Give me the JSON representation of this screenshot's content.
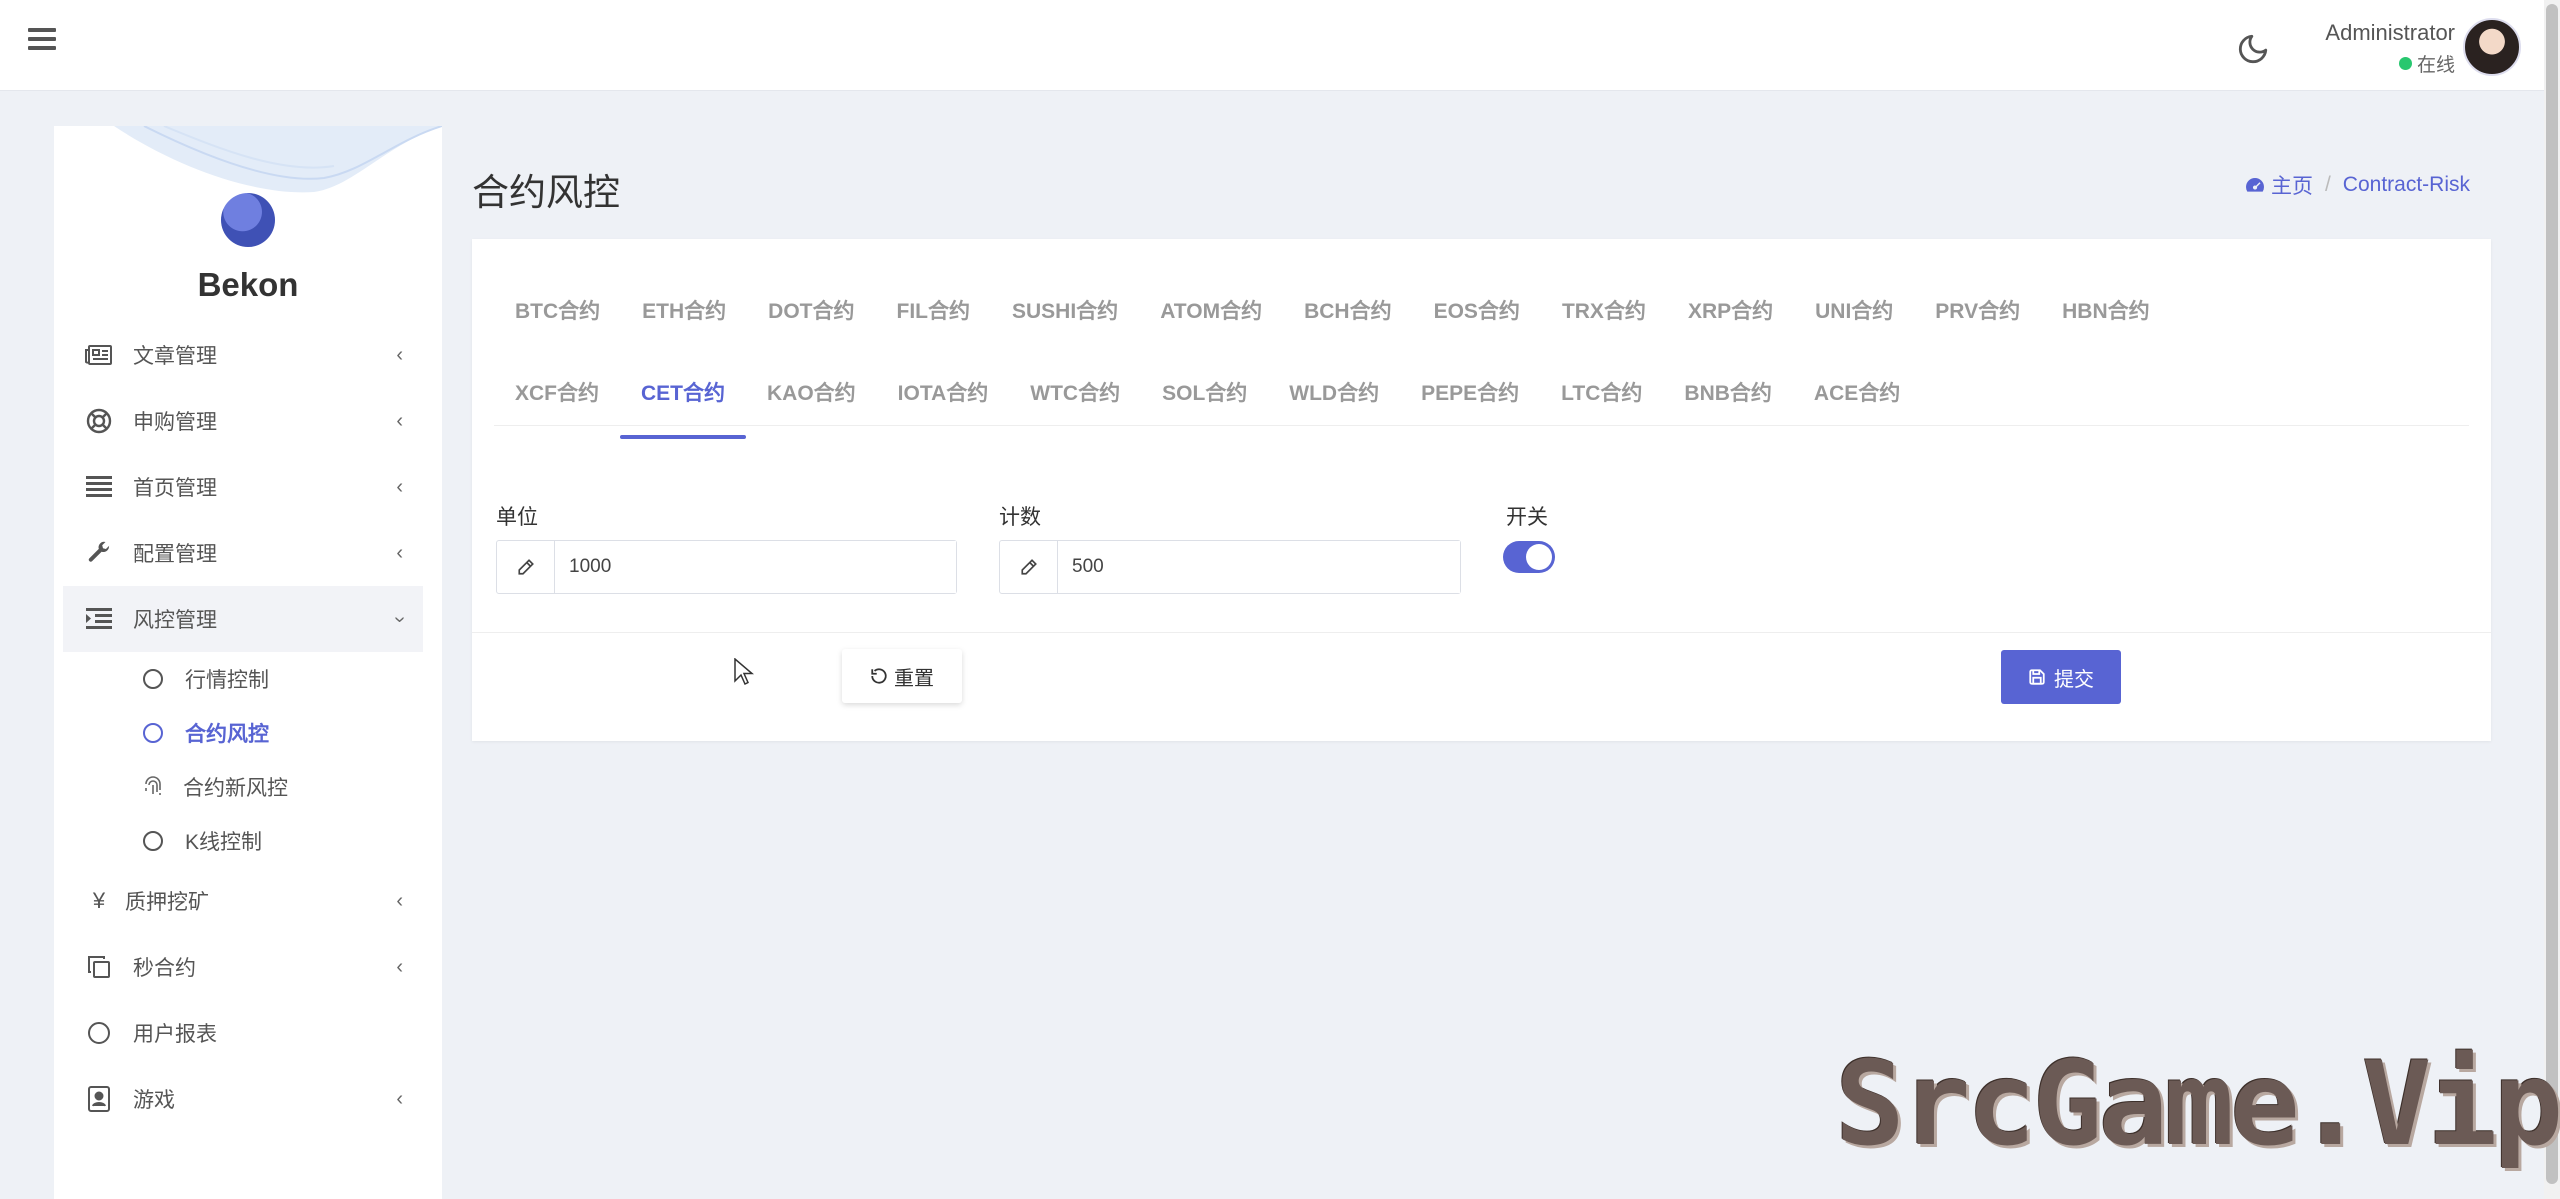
{
  "topbar": {
    "user_name": "Administrator",
    "user_status": "在线"
  },
  "sidebar": {
    "brand": "Bekon",
    "items": [
      {
        "label": "文章管理",
        "icon": "newspaper-icon"
      },
      {
        "label": "申购管理",
        "icon": "lifebuoy-icon"
      },
      {
        "label": "首页管理",
        "icon": "list-icon"
      },
      {
        "label": "配置管理",
        "icon": "wrench-icon"
      },
      {
        "label": "风控管理",
        "icon": "indent-icon"
      }
    ],
    "subitems": [
      {
        "label": "行情控制"
      },
      {
        "label": "合约风控"
      },
      {
        "label": "合约新风控"
      },
      {
        "label": "K线控制"
      }
    ],
    "items_after": [
      {
        "label": "质押挖矿",
        "icon": "yen-icon"
      },
      {
        "label": "秒合约",
        "icon": "copy-icon"
      },
      {
        "label": "用户报表",
        "icon": "circle-icon"
      },
      {
        "label": "游戏",
        "icon": "id-card-icon"
      }
    ]
  },
  "page": {
    "title": "合约风控",
    "breadcrumb_home": "主页",
    "breadcrumb_current": "Contract-Risk"
  },
  "tabs": {
    "row1": [
      "BTC合约",
      "ETH合约",
      "DOT合约",
      "FIL合约",
      "SUSHI合约",
      "ATOM合约",
      "BCH合约",
      "EOS合约",
      "TRX合约",
      "XRP合约",
      "UNI合约",
      "PRV合约",
      "HBN合约"
    ],
    "row2": [
      "XCF合约",
      "CET合约",
      "KAO合约",
      "IOTA合约",
      "WTC合约",
      "SOL合约",
      "WLD合约",
      "PEPE合约",
      "LTC合约",
      "BNB合约",
      "ACE合约"
    ],
    "active": "CET合约"
  },
  "form": {
    "unit_label": "单位",
    "unit_value": "1000",
    "count_label": "计数",
    "count_value": "500",
    "switch_label": "开关",
    "switch_on": true,
    "reset_label": "重置",
    "submit_label": "提交"
  },
  "watermark": "SrcGame.Vip",
  "colors": {
    "accent": "#5864d3",
    "background": "#eef1f6",
    "online": "#28c76f"
  }
}
